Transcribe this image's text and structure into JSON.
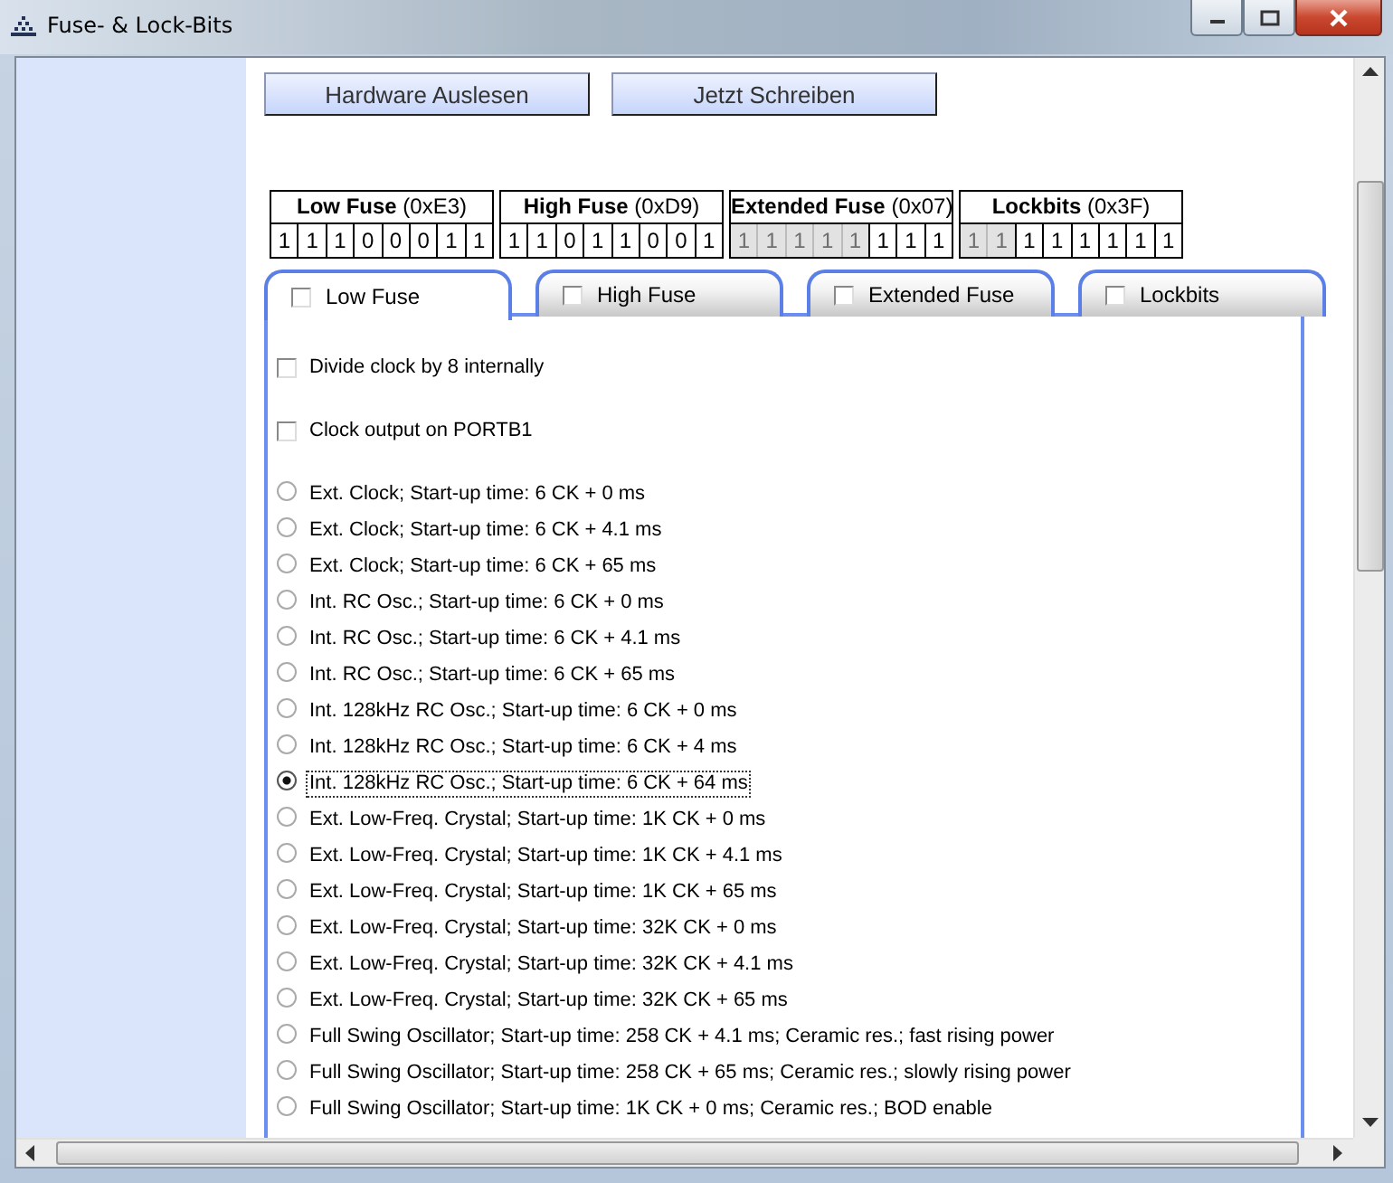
{
  "window": {
    "title": "Fuse- & Lock-Bits"
  },
  "actions": [
    {
      "label": "Hardware Auslesen"
    },
    {
      "label": "Jetzt Schreiben"
    }
  ],
  "fuse_bytes": [
    {
      "name": "Low Fuse",
      "value": "(0xE3)",
      "bits": [
        {
          "value": "1",
          "disabled": false
        },
        {
          "value": "1",
          "disabled": false
        },
        {
          "value": "1",
          "disabled": false
        },
        {
          "value": "0",
          "disabled": false
        },
        {
          "value": "0",
          "disabled": false
        },
        {
          "value": "0",
          "disabled": false
        },
        {
          "value": "1",
          "disabled": false
        },
        {
          "value": "1",
          "disabled": false
        }
      ]
    },
    {
      "name": "High Fuse",
      "value": "(0xD9)",
      "bits": [
        {
          "value": "1",
          "disabled": false
        },
        {
          "value": "1",
          "disabled": false
        },
        {
          "value": "0",
          "disabled": false
        },
        {
          "value": "1",
          "disabled": false
        },
        {
          "value": "1",
          "disabled": false
        },
        {
          "value": "0",
          "disabled": false
        },
        {
          "value": "0",
          "disabled": false
        },
        {
          "value": "1",
          "disabled": false
        }
      ]
    },
    {
      "name": "Extended Fuse",
      "value": "(0x07)",
      "bits": [
        {
          "value": "1",
          "disabled": true
        },
        {
          "value": "1",
          "disabled": true
        },
        {
          "value": "1",
          "disabled": true
        },
        {
          "value": "1",
          "disabled": true
        },
        {
          "value": "1",
          "disabled": true
        },
        {
          "value": "1",
          "disabled": false
        },
        {
          "value": "1",
          "disabled": false
        },
        {
          "value": "1",
          "disabled": false
        }
      ]
    },
    {
      "name": "Lockbits",
      "value": "(0x3F)",
      "bits": [
        {
          "value": "1",
          "disabled": true
        },
        {
          "value": "1",
          "disabled": true
        },
        {
          "value": "1",
          "disabled": false
        },
        {
          "value": "1",
          "disabled": false
        },
        {
          "value": "1",
          "disabled": false
        },
        {
          "value": "1",
          "disabled": false
        },
        {
          "value": "1",
          "disabled": false
        },
        {
          "value": "1",
          "disabled": false
        }
      ]
    }
  ],
  "tabs": [
    {
      "label": "Low Fuse",
      "selected": true,
      "checked": false
    },
    {
      "label": "High Fuse",
      "selected": false,
      "checked": false
    },
    {
      "label": "Extended Fuse",
      "selected": false,
      "checked": false
    },
    {
      "label": "Lockbits",
      "selected": false,
      "checked": false
    }
  ],
  "options": [
    {
      "kind": "checkbox",
      "label": "Divide clock by 8 internally",
      "checked": false
    },
    {
      "kind": "checkbox",
      "label": "Clock output on PORTB1",
      "checked": false
    },
    {
      "kind": "radio",
      "label": "Ext. Clock; Start-up time: 6 CK + 0 ms",
      "selected": false,
      "focused": false
    },
    {
      "kind": "radio",
      "label": "Ext. Clock; Start-up time: 6 CK + 4.1 ms",
      "selected": false,
      "focused": false
    },
    {
      "kind": "radio",
      "label": "Ext. Clock; Start-up time: 6 CK + 65 ms",
      "selected": false,
      "focused": false
    },
    {
      "kind": "radio",
      "label": "Int. RC Osc.; Start-up time: 6 CK + 0 ms",
      "selected": false,
      "focused": false
    },
    {
      "kind": "radio",
      "label": "Int. RC Osc.; Start-up time: 6 CK + 4.1 ms",
      "selected": false,
      "focused": false
    },
    {
      "kind": "radio",
      "label": "Int. RC Osc.; Start-up time: 6 CK + 65 ms",
      "selected": false,
      "focused": false
    },
    {
      "kind": "radio",
      "label": "Int. 128kHz RC Osc.; Start-up time: 6 CK + 0 ms",
      "selected": false,
      "focused": false
    },
    {
      "kind": "radio",
      "label": "Int. 128kHz RC Osc.; Start-up time: 6 CK + 4 ms",
      "selected": false,
      "focused": false
    },
    {
      "kind": "radio",
      "label": "Int. 128kHz RC Osc.; Start-up time: 6 CK + 64 ms",
      "selected": true,
      "focused": true
    },
    {
      "kind": "radio",
      "label": "Ext. Low-Freq. Crystal; Start-up time: 1K CK + 0 ms",
      "selected": false,
      "focused": false
    },
    {
      "kind": "radio",
      "label": "Ext. Low-Freq. Crystal; Start-up time: 1K CK + 4.1 ms",
      "selected": false,
      "focused": false
    },
    {
      "kind": "radio",
      "label": "Ext. Low-Freq. Crystal; Start-up time: 1K CK + 65 ms",
      "selected": false,
      "focused": false
    },
    {
      "kind": "radio",
      "label": "Ext. Low-Freq. Crystal; Start-up time: 32K CK + 0 ms",
      "selected": false,
      "focused": false
    },
    {
      "kind": "radio",
      "label": "Ext. Low-Freq. Crystal; Start-up time: 32K CK + 4.1 ms",
      "selected": false,
      "focused": false
    },
    {
      "kind": "radio",
      "label": "Ext. Low-Freq. Crystal; Start-up time: 32K CK + 65 ms",
      "selected": false,
      "focused": false
    },
    {
      "kind": "radio",
      "label": "Full Swing Oscillator; Start-up time: 258 CK + 4.1 ms; Ceramic res.; fast rising power",
      "selected": false,
      "focused": false
    },
    {
      "kind": "radio",
      "label": "Full Swing Oscillator; Start-up time: 258 CK + 65 ms; Ceramic res.; slowly rising power",
      "selected": false,
      "focused": false
    },
    {
      "kind": "radio",
      "label": "Full Swing Oscillator; Start-up time: 1K CK + 0 ms; Ceramic res.; BOD enable",
      "selected": false,
      "focused": false
    }
  ]
}
